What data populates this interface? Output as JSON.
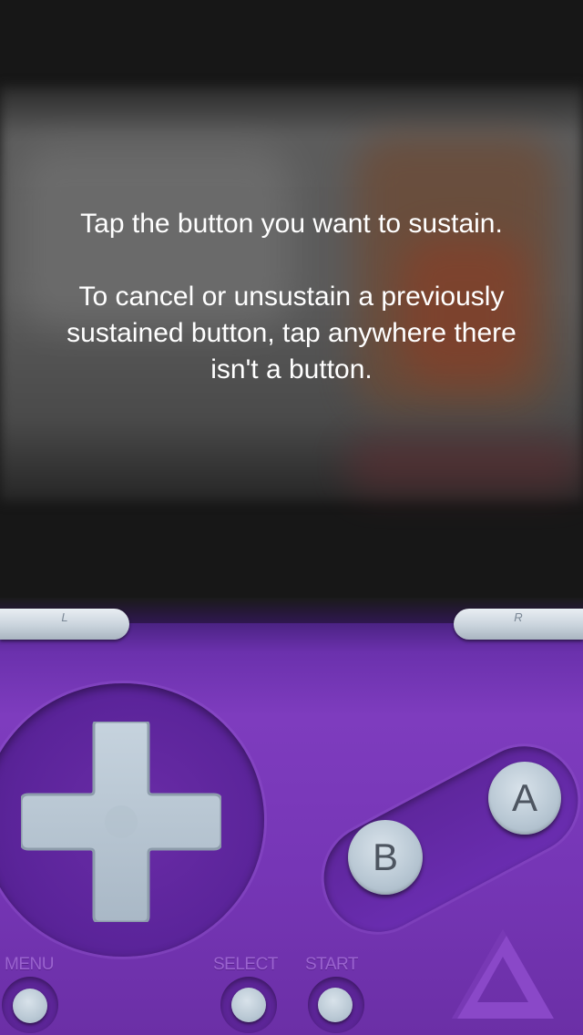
{
  "overlay": {
    "line1": "Tap the button you want to sustain.",
    "line2": "To cancel or unsustain a previously",
    "line3": "sustained button, tap anywhere there",
    "line4": "isn't a button."
  },
  "controller": {
    "shoulder_left_label": "L",
    "shoulder_right_label": "R",
    "button_a_label": "A",
    "button_b_label": "B",
    "menu_label": "MENU",
    "select_label": "SELECT",
    "start_label": "START",
    "logo_icon": "delta-logo-icon"
  },
  "colors": {
    "controller_purple": "#7a38ba",
    "button_silver": "#b9c8d4"
  }
}
